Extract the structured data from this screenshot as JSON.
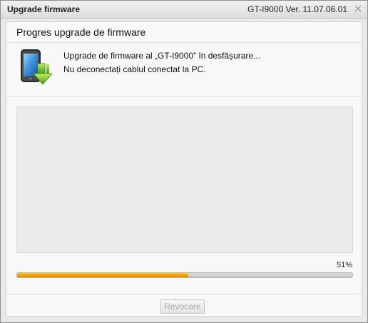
{
  "window": {
    "title": "Upgrade firmware",
    "version": "GT-I9000 Ver. 11.07.06.01"
  },
  "header": {
    "heading": "Progres upgrade de firmware",
    "message_line1": "Upgrade de firmware al „GT-I9000” în desfășurare...",
    "message_line2": "Nu deconectați cablul conectat la PC.",
    "icon": "phone-download-icon"
  },
  "progress": {
    "percent_label": "51%",
    "value": 0.51,
    "fill_color": "#f29b00"
  },
  "footer": {
    "cancel_label": "Revocare",
    "cancel_enabled": false
  }
}
